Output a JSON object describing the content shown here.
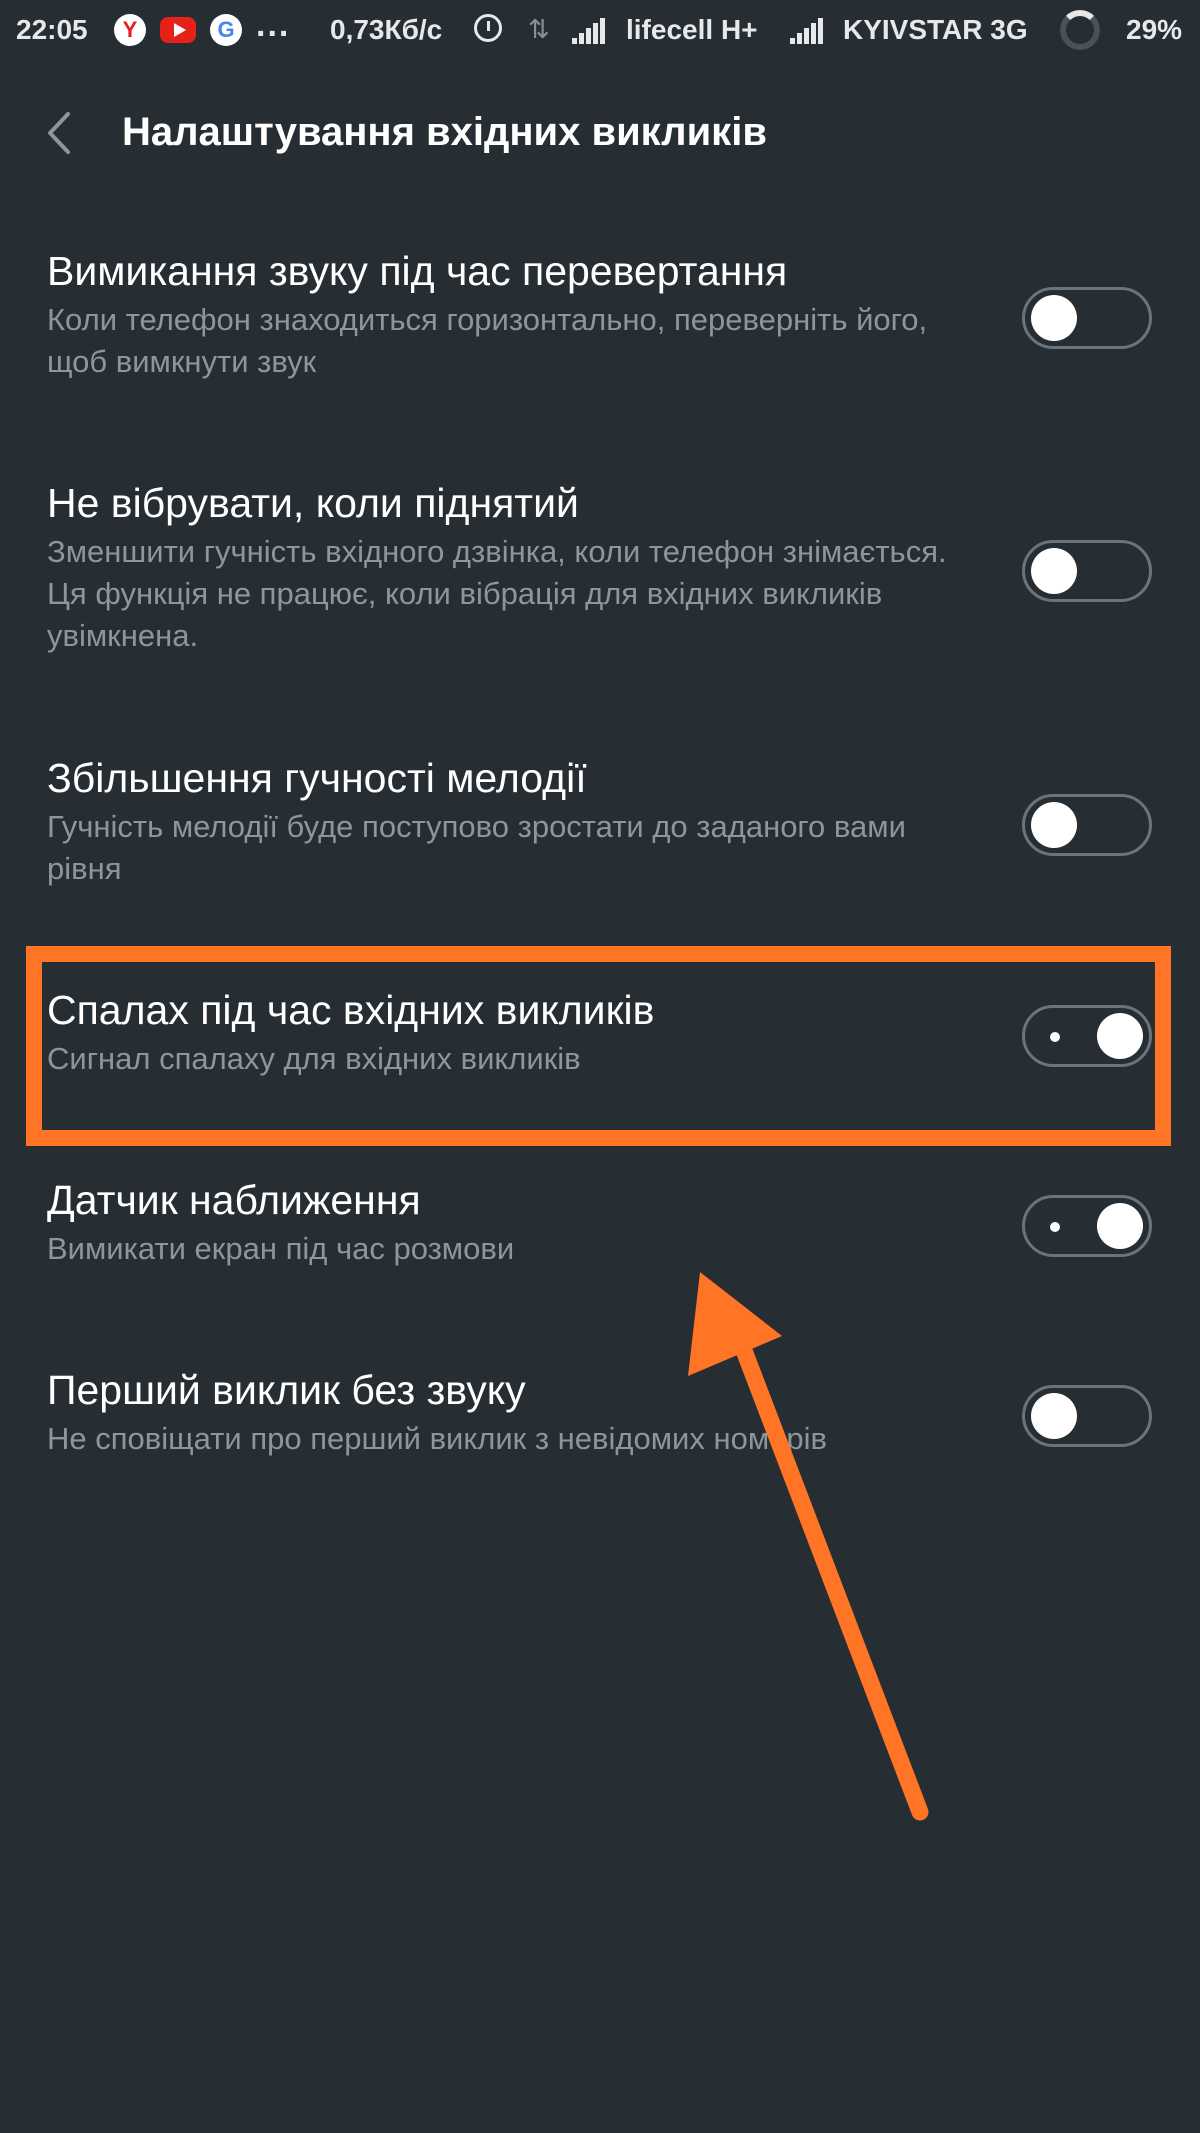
{
  "status_bar": {
    "time": "22:05",
    "yandex_letter": "Y",
    "google_letter": "G",
    "more": "...",
    "speed": "0,73Кб/с",
    "data_indicator": "⇅",
    "carrier1": "lifecell  H+",
    "carrier2": "KYIVSTAR 3G",
    "battery": "29%",
    "icons": [
      "yandex-icon",
      "youtube-icon",
      "google-icon",
      "alarm-icon",
      "signal-icon",
      "battery-ring-icon"
    ]
  },
  "header": {
    "title": "Налаштування вхідних викликів",
    "back_icon": "chevron-left-icon"
  },
  "settings": [
    {
      "title": "Вимикання звуку під час перевертання",
      "description": "Коли телефон знаходиться горизонтально, переверніть його, щоб вимкнути звук",
      "enabled": false
    },
    {
      "title": "Не вібрувати, коли піднятий",
      "description": "Зменшити гучність вхідного дзвінка, коли телефон знімається. Ця функція не працює, коли вібрація для вхідних викликів увімкнена.",
      "enabled": false
    },
    {
      "title": "Збільшення гучності мелодії",
      "description": "Гучність мелодії буде поступово зростати до заданого вами рівня",
      "enabled": false
    },
    {
      "title": "Спалах під час вхідних викликів",
      "description": "Сигнал спалаху для вхідних викликів",
      "enabled": true
    },
    {
      "title": "Датчик наближення",
      "description": "Вимикати екран під час розмови",
      "enabled": true
    },
    {
      "title": "Перший виклик без звуку",
      "description": "Не сповіщати про перший виклик з невідомих номерів",
      "enabled": false
    }
  ],
  "colors": {
    "background": "#262d33",
    "annotation": "#ff7425",
    "description_text": "#8e969d"
  }
}
